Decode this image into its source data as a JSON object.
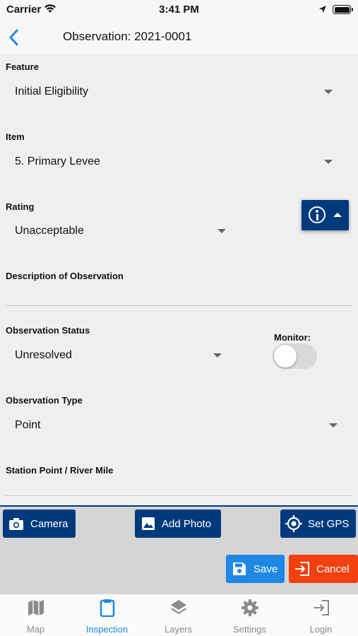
{
  "status_bar": {
    "carrier": "Carrier",
    "time": "3:41 PM"
  },
  "navbar": {
    "title": "Observation: 2021-0001"
  },
  "form": {
    "feature_label": "Feature",
    "feature_value": "Initial Eligibility",
    "item_label": "Item",
    "item_value": "5. Primary Levee",
    "rating_label": "Rating",
    "rating_value": "Unacceptable",
    "description_label": "Description of Observation",
    "status_label": "Observation Status",
    "status_value": "Unresolved",
    "monitor_label": "Monitor:",
    "monitor_on": false,
    "type_label": "Observation Type",
    "type_value": "Point",
    "station_label": "Station Point / River Mile"
  },
  "actions": {
    "camera": "Camera",
    "add_photo": "Add Photo",
    "set_gps": "Set GPS",
    "save": "Save",
    "cancel": "Cancel"
  },
  "tabs": [
    {
      "label": "Map",
      "icon": "map-icon"
    },
    {
      "label": "Inspection",
      "icon": "clipboard-icon",
      "active": true
    },
    {
      "label": "Layers",
      "icon": "layers-icon"
    },
    {
      "label": "Settings",
      "icon": "gear-icon"
    },
    {
      "label": "Login",
      "icon": "login-icon"
    }
  ],
  "colors": {
    "primary_navy": "#003a7d",
    "accent_blue": "#1e88e5",
    "cancel_orange": "#f4400f",
    "background": "#efefef"
  }
}
